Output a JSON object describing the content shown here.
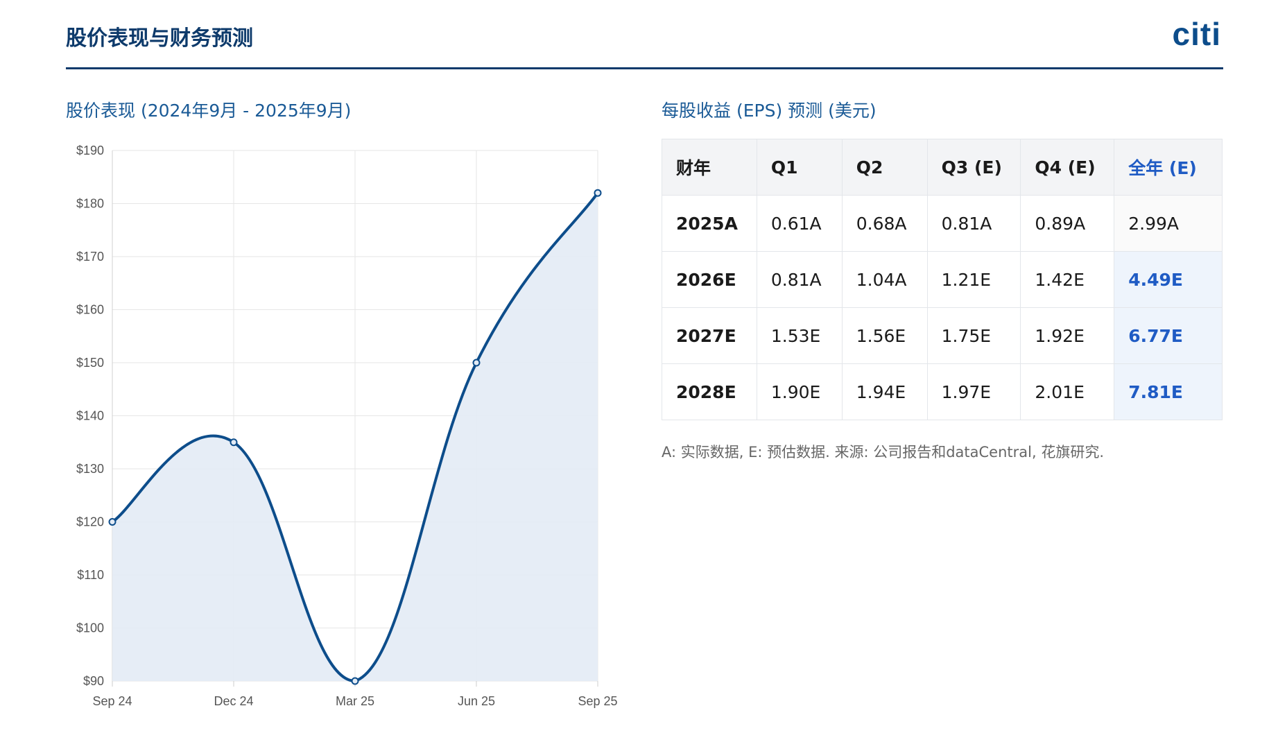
{
  "header": {
    "title": "股价表现与财务预测",
    "logo_text": "citi"
  },
  "chart_section": {
    "title": "股价表现 (2024年9月 - 2025年9月)"
  },
  "table_section": {
    "title": "每股收益 (EPS) 预测 (美元)",
    "headers": [
      "财年",
      "Q1",
      "Q2",
      "Q3 (E)",
      "Q4 (E)",
      "全年 (E)"
    ],
    "rows": [
      [
        "2025A",
        "0.61A",
        "0.68A",
        "0.81A",
        "0.89A",
        "2.99A"
      ],
      [
        "2026E",
        "0.81A",
        "1.04A",
        "1.21E",
        "1.42E",
        "4.49E"
      ],
      [
        "2027E",
        "1.53E",
        "1.56E",
        "1.75E",
        "1.92E",
        "6.77E"
      ],
      [
        "2028E",
        "1.90E",
        "1.94E",
        "1.97E",
        "2.01E",
        "7.81E"
      ]
    ],
    "footnote": "A: 实际数据, E: 预估数据. 来源: 公司报告和dataCentral, 花旗研究."
  },
  "colors": {
    "accent": "#0d3a6b",
    "line": "#0d4d8b",
    "fill": "#e3ebf5",
    "highlight": "#1f5bc4"
  },
  "chart_data": {
    "type": "area",
    "categories": [
      "Sep 24",
      "Dec 24",
      "Mar 25",
      "Jun 25",
      "Sep 25"
    ],
    "values": [
      120,
      135,
      90,
      150,
      182
    ],
    "ylim": [
      90,
      190
    ],
    "yticks": [
      90,
      100,
      110,
      120,
      130,
      140,
      150,
      160,
      170,
      180,
      190
    ],
    "ytick_labels": [
      "$90",
      "$100",
      "$110",
      "$120",
      "$130",
      "$140",
      "$150",
      "$160",
      "$170",
      "$180",
      "$190"
    ],
    "grid": true
  }
}
